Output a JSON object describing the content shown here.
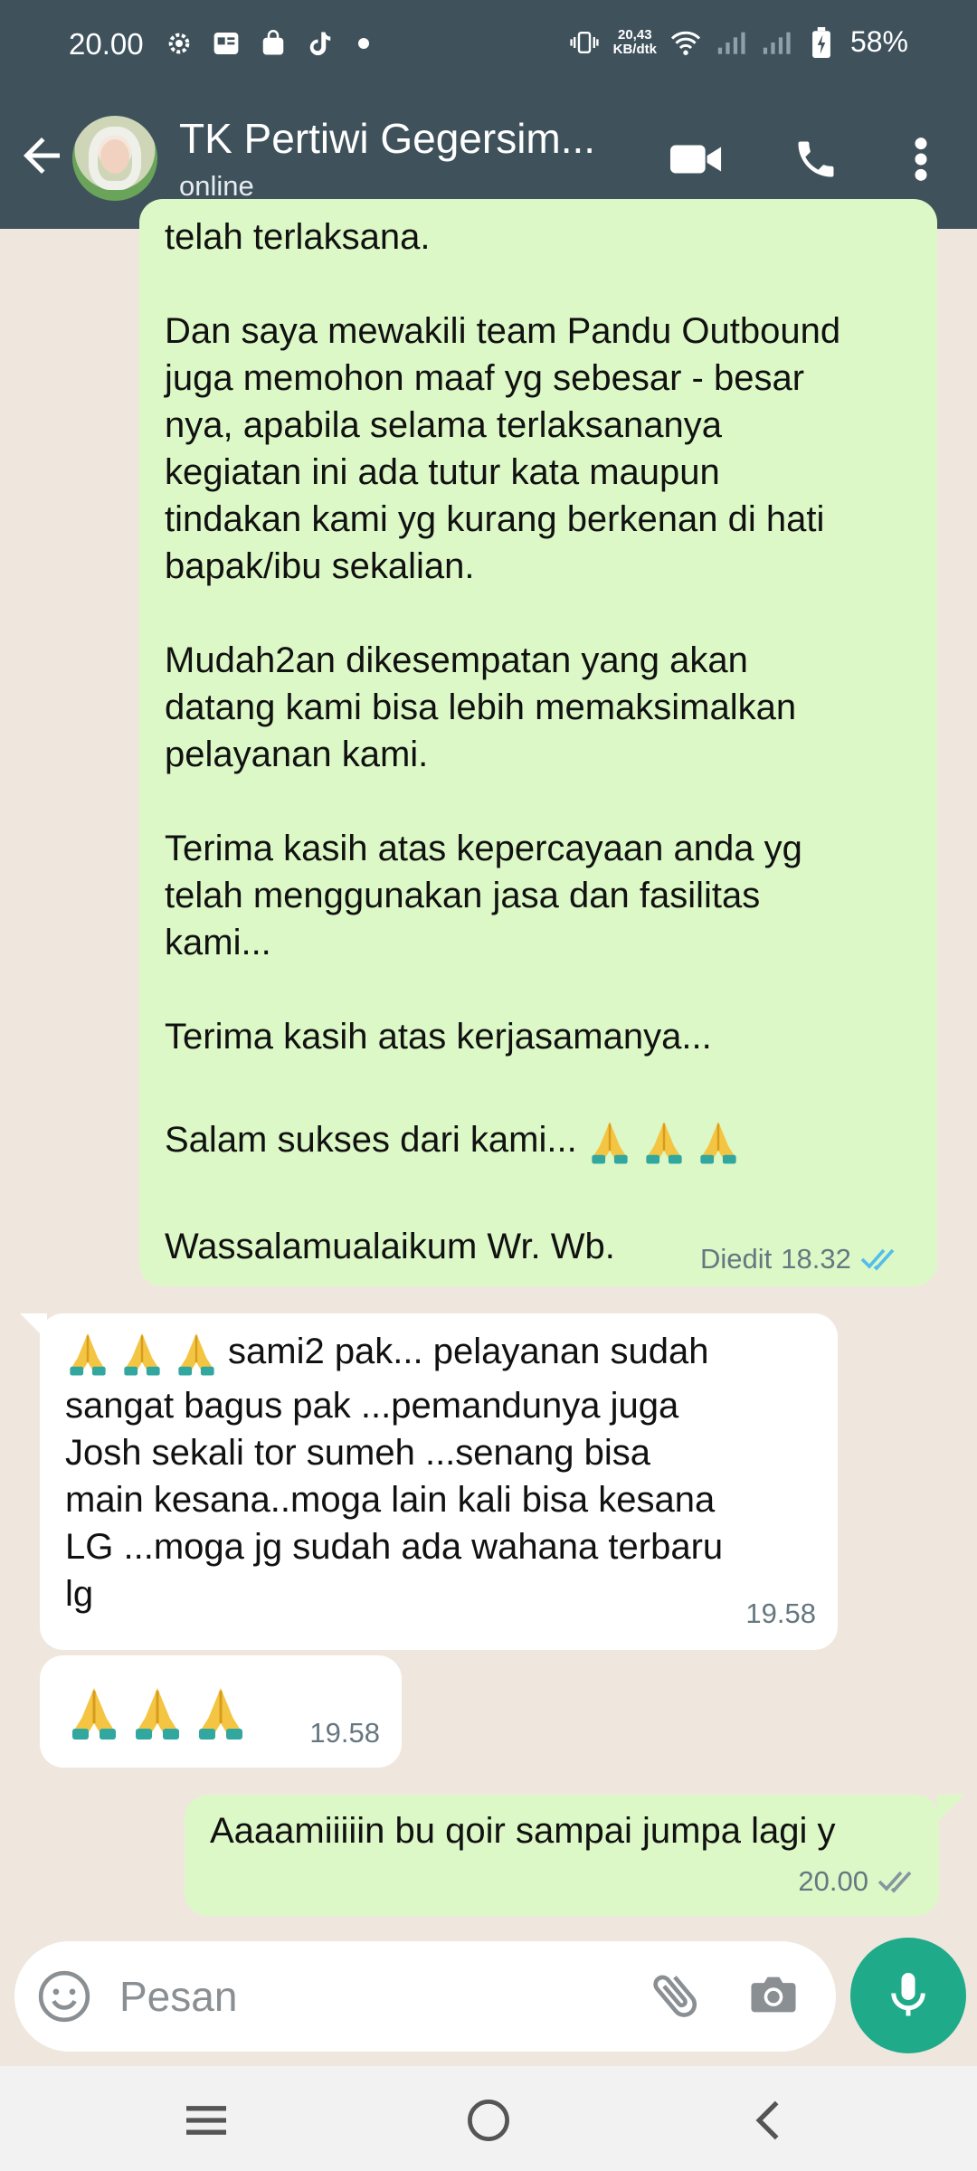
{
  "status_bar": {
    "time": "20.00",
    "net_speed_value": "20,43",
    "net_speed_unit": "KB/dtk",
    "battery": "58%"
  },
  "header": {
    "contact_name": "TK Pertiwi Gegersim...",
    "presence": "online"
  },
  "messages": [
    {
      "direction": "outgoing",
      "text": "telah terlaksana.\n\nDan saya mewakili team Pandu Outbound\njuga memohon maaf yg sebesar - besar\nnya, apabila selama terlaksananya\nkegiatan ini ada tutur kata maupun\ntindakan kami yg kurang berkenan di hati\nbapak/ibu sekalian.\n\nMudah2an dikesempatan yang akan\ndatang kami bisa lebih memaksimalkan\npelayanan kami.\n\nTerima kasih atas kepercayaan anda yg\ntelah menggunakan jasa dan fasilitas\nkami...\n\nTerima kasih atas kerjasamanya...",
      "closing_text": "Salam sukses dari kami...",
      "closing_emoji": "🙏🙏🙏",
      "final_text": "Wassalamualaikum Wr. Wb.",
      "edited_label": "Diedit",
      "time": "18.32",
      "ticks": "read"
    },
    {
      "direction": "incoming",
      "emoji": "🙏🙏🙏",
      "text": "sami2 pak... pelayanan sudah\nsangat bagus pak ...pemandunya juga\nJosh sekali tor sumeh ...senang bisa\nmain kesana..moga lain kali bisa kesana\nLG ...moga jg sudah ada wahana terbaru\nlg",
      "time": "19.58"
    },
    {
      "direction": "incoming",
      "emoji": "🙏🙏🙏",
      "time": "19.58"
    },
    {
      "direction": "outgoing",
      "text": "Aaaamiiiiin bu qoir sampai jumpa lagi y",
      "time": "20.00",
      "ticks": "delivered"
    }
  ],
  "composer": {
    "placeholder": "Pesan"
  },
  "colors": {
    "header_bg": "#3f525c",
    "outgoing_bubble": "#dcf8c6",
    "incoming_bubble": "#ffffff",
    "chat_bg": "#efe7de",
    "read_ticks": "#53bdeb",
    "mic_button": "#1faa8a"
  },
  "icons": {
    "back": "arrow-left-icon",
    "video": "video-camera-icon",
    "call": "phone-icon",
    "menu": "more-vertical-icon",
    "emoji": "smiley-icon",
    "attach": "paperclip-icon",
    "camera": "camera-icon",
    "mic": "microphone-icon"
  }
}
